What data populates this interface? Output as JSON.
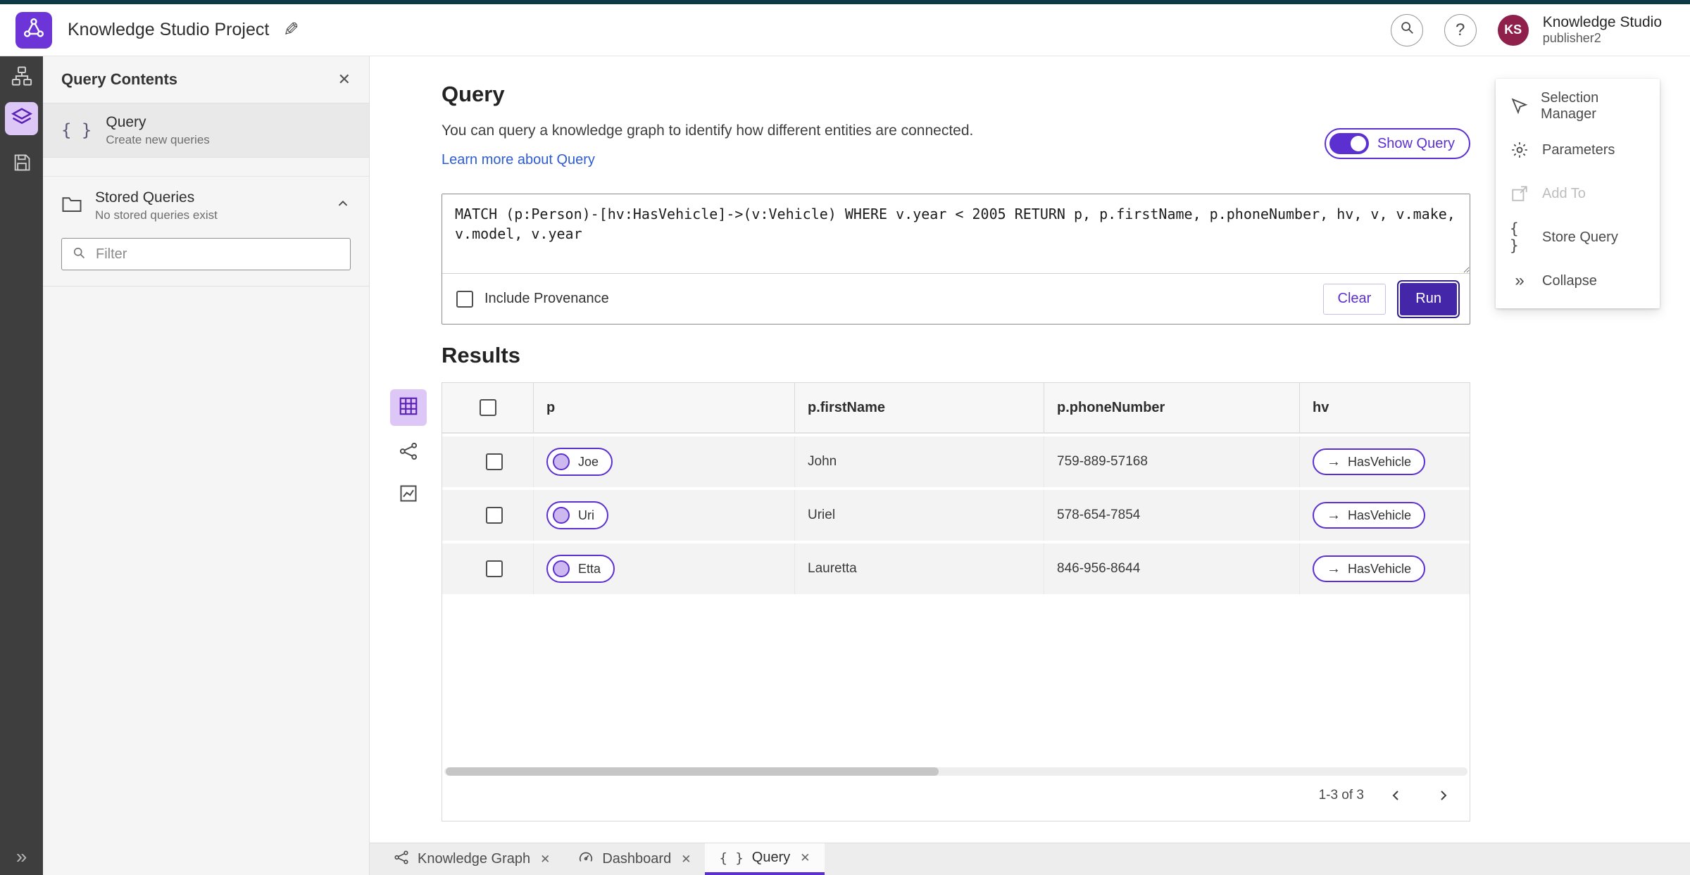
{
  "icons": {
    "braces": "{ }",
    "collapse_chevrons": "»",
    "edit": "✎",
    "close": "✕",
    "help": "?",
    "arrow_right": "→"
  },
  "header": {
    "title": "Knowledge Studio Project",
    "user_org": "Knowledge Studio",
    "user_name": "publisher2",
    "avatar_initials": "KS"
  },
  "left_panel": {
    "title": "Query Contents",
    "query_item": {
      "label": "Query",
      "description": "Create new queries"
    },
    "stored": {
      "label": "Stored Queries",
      "description": "No stored queries exist"
    },
    "filter_placeholder": "Filter"
  },
  "query_section": {
    "heading": "Query",
    "description": "You can query a knowledge graph to identify how different entities are connected.",
    "learn_more": "Learn more about Query",
    "show_query": "Show Query",
    "code": "MATCH (p:Person)-[hv:HasVehicle]->(v:Vehicle) WHERE v.year < 2005 RETURN p, p.firstName, p.phoneNumber, hv, v, v.make, v.model, v.year",
    "include_provenance": "Include Provenance",
    "clear": "Clear",
    "run": "Run"
  },
  "results": {
    "heading": "Results",
    "columns": {
      "p": "p",
      "first_name": "p.firstName",
      "phone": "p.phoneNumber",
      "hv": "hv"
    },
    "rows": [
      {
        "p": "Joe",
        "firstName": "John",
        "phone": "759-889-57168",
        "hv": "HasVehicle"
      },
      {
        "p": "Uri",
        "firstName": "Uriel",
        "phone": "578-654-7854",
        "hv": "HasVehicle"
      },
      {
        "p": "Etta",
        "firstName": "Lauretta",
        "phone": "846-956-8644",
        "hv": "HasVehicle"
      }
    ],
    "pagination": "1-3 of 3"
  },
  "side_menu": {
    "selection_manager": "Selection Manager",
    "parameters": "Parameters",
    "add_to": "Add To",
    "store_query": "Store Query",
    "collapse": "Collapse"
  },
  "tabs": [
    {
      "label": "Knowledge Graph"
    },
    {
      "label": "Dashboard"
    },
    {
      "label": "Query"
    }
  ],
  "colors": {
    "primary_purple": "#5b2fd0",
    "run_button": "#4327a8",
    "accent_light_purple": "#dcc7f7",
    "link_blue": "#2d5bd1",
    "top_strip": "#0d3a44",
    "avatar_maroon": "#8f1f4b",
    "rail_gray": "#3e3e3e"
  }
}
